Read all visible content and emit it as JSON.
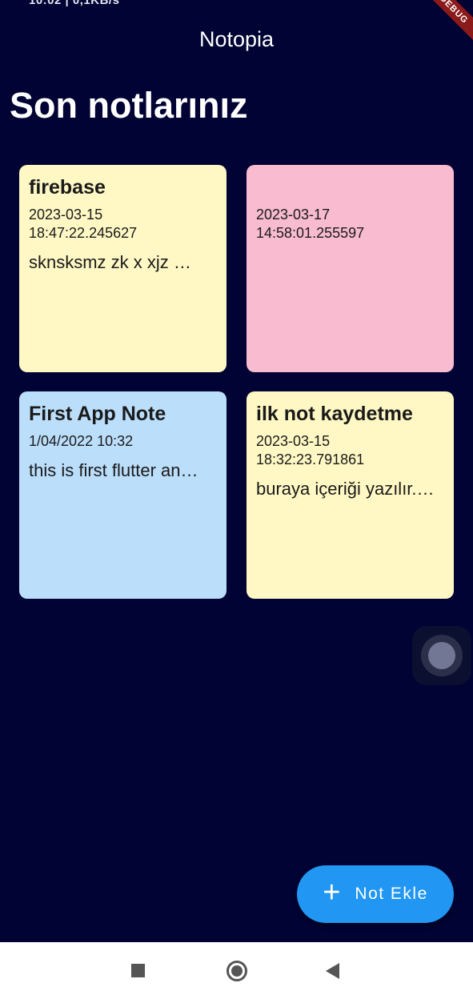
{
  "status_bar": {
    "left_text": "10:02 | 0,1KB/s",
    "right_text": "..."
  },
  "debug_banner": "DEBUG",
  "app_bar": {
    "title": "Notopia"
  },
  "heading": "Son notlarınız",
  "notes": [
    {
      "title": "firebase",
      "date": "2023-03-15 18:47:22.245627",
      "content": "sknsksmz zk x xjz …",
      "color": "#fff8c4"
    },
    {
      "title": "",
      "date": "2023-03-17 14:58:01.255597",
      "content": "",
      "color": "#f8bbd0"
    },
    {
      "title": "First App Note",
      "date": "1/04/2022 10:32",
      "content": "this is first flutter an…",
      "color": "#bbdefb"
    },
    {
      "title": "ilk not kaydetme",
      "date": "2023-03-15 18:32:23.791861",
      "content": "buraya içeriği yazılır.…",
      "color": "#fff8c4"
    }
  ],
  "fab": {
    "icon": "plus-icon",
    "label": "Not Ekle",
    "color": "#2196f3"
  },
  "nav_bar": {
    "icons": [
      "recents-square-icon",
      "home-circle-icon",
      "back-triangle-icon"
    ]
  },
  "colors": {
    "background": "#000333",
    "text_on_bg": "#ffffff"
  }
}
